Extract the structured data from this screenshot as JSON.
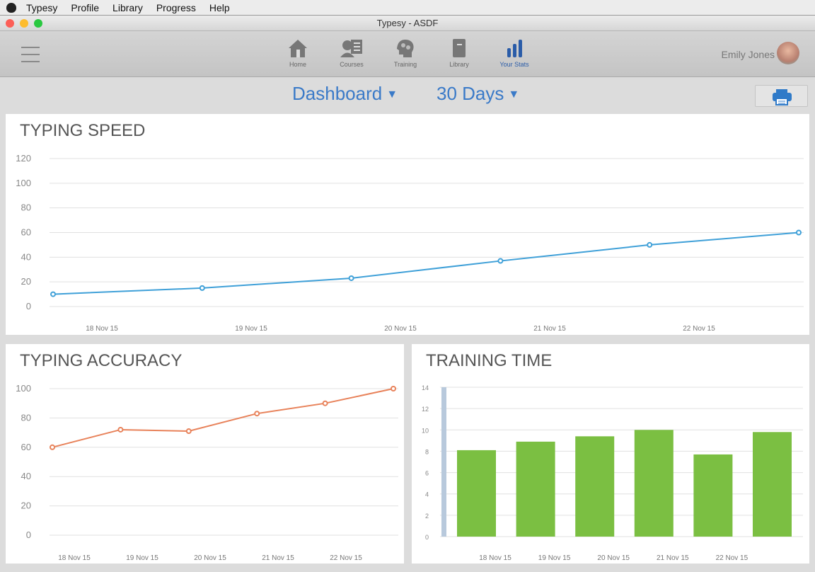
{
  "menubar": {
    "items": [
      "Typesy",
      "Profile",
      "Library",
      "Progress",
      "Help"
    ]
  },
  "window": {
    "title": "Typesy - ASDF"
  },
  "toolbar": {
    "nav": [
      {
        "label": "Home",
        "icon": "home-icon"
      },
      {
        "label": "Courses",
        "icon": "courses-icon"
      },
      {
        "label": "Training",
        "icon": "brain-gears-icon"
      },
      {
        "label": "Library",
        "icon": "book-icon"
      },
      {
        "label": "Your Stats",
        "icon": "bar-chart-icon",
        "active": true
      }
    ],
    "user": "Emily Jones",
    "accent": "#2a5ca8"
  },
  "filters": {
    "view": "Dashboard",
    "range": "30 Days"
  },
  "chart_data": [
    {
      "type": "line",
      "title": "TYPING SPEED",
      "color": "#3fa0d8",
      "ylim": [
        0,
        120
      ],
      "yticks": [
        0,
        20,
        40,
        60,
        80,
        100,
        120
      ],
      "xtick_labels": [
        "18 Nov 15",
        "19 Nov 15",
        "20 Nov 15",
        "21 Nov 15",
        "22 Nov 15"
      ],
      "values": [
        10,
        15,
        23,
        37,
        50,
        60
      ]
    },
    {
      "type": "line",
      "title": "TYPING ACCURACY",
      "color": "#e8825a",
      "ylim": [
        0,
        100
      ],
      "yticks": [
        0,
        20,
        40,
        60,
        80,
        100
      ],
      "xtick_labels": [
        "18 Nov 15",
        "19 Nov 15",
        "20 Nov 15",
        "21 Nov 15",
        "22 Nov 15"
      ],
      "values": [
        60,
        72,
        71,
        83,
        90,
        100
      ]
    },
    {
      "type": "bar",
      "title": "TRAINING TIME",
      "color": "#7bbf42",
      "ylim": [
        0,
        14
      ],
      "yticks": [
        0,
        2,
        4,
        6,
        8,
        10,
        12,
        14
      ],
      "xtick_labels": [
        "18 Nov 15",
        "19 Nov 15",
        "20 Nov 15",
        "21 Nov 15",
        "22 Nov 15"
      ],
      "values": [
        8.1,
        8.9,
        9.4,
        10.0,
        7.7,
        9.8
      ]
    }
  ]
}
